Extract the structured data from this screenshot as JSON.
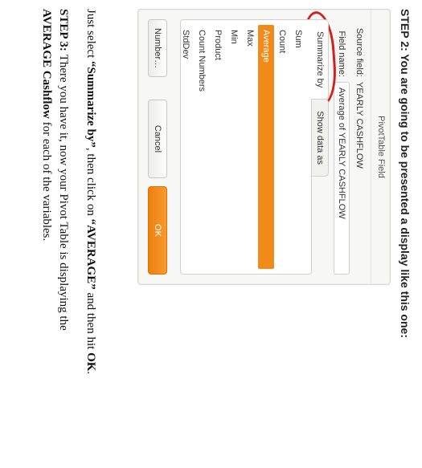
{
  "partial_header": "STEP 2: You are going to be presented a display like this one:",
  "dialog": {
    "title": "PivotTable Field",
    "source_label": "Source field:",
    "source_value": "YEARLY CASHFLOW",
    "fieldname_label": "Field name:",
    "fieldname_value": "Average of YEARLY CASHFLOW",
    "tab_summarize": "Summarize by",
    "tab_showdata": "Show data as",
    "options": [
      "Sum",
      "Count",
      "Average",
      "Max",
      "Min",
      "Product",
      "Count Numbers",
      "StdDev"
    ],
    "selected_index": 2,
    "btn_number": "Number…",
    "btn_cancel": "Cancel",
    "btn_ok": "OK"
  },
  "caption1a": "Just select ",
  "caption1b": "“Summarize by”",
  "caption1c": ", then click on ",
  "caption1d": "“AVERAGE”",
  "caption1e": " and then hit ",
  "caption1f": "OK",
  "caption1g": ".",
  "caption2a": "STEP 3: ",
  "caption2b": "There you have it, now your Pivot Table is displaying the ",
  "caption2c": "AVERAGE Cashflow",
  "caption2d": " for each of the variables."
}
